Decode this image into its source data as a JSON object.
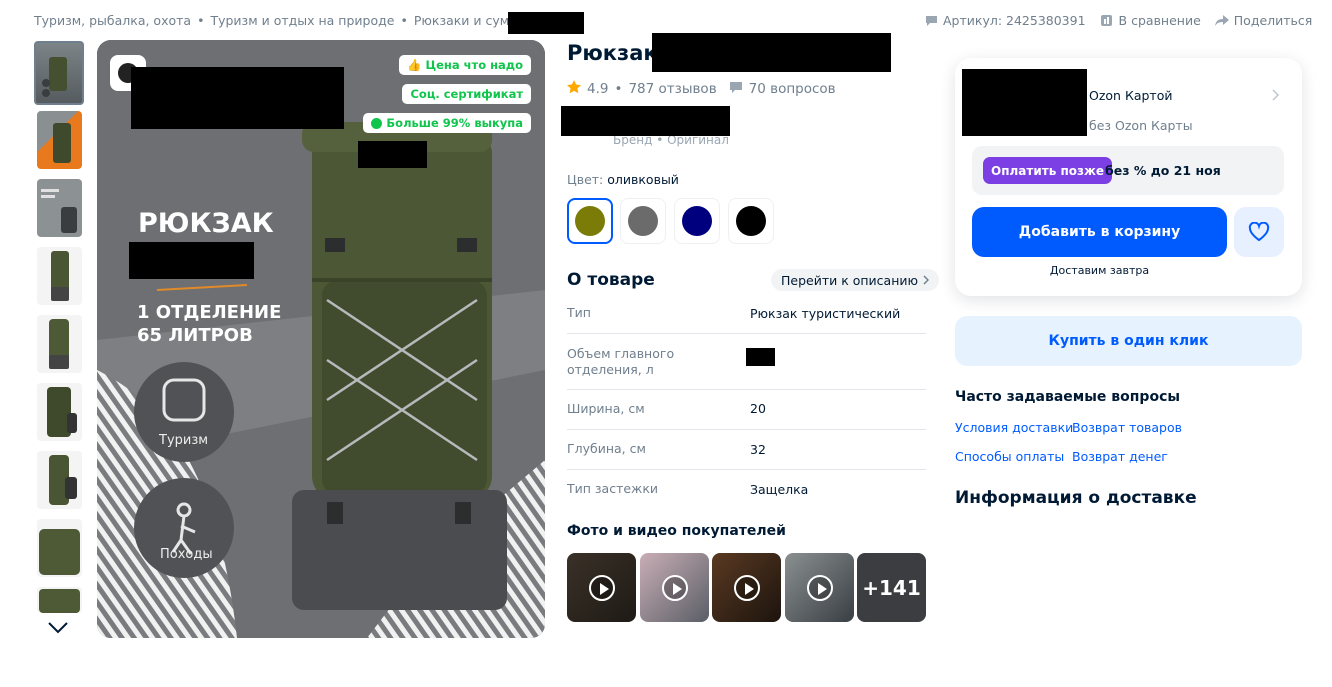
{
  "breadcrumbs": [
    "Туризм, рыбалка, охота",
    "Туризм и отдых на природе",
    "Рюкзаки и сумки"
  ],
  "breadcrumb_sep": "•",
  "top_actions": {
    "article": "Артикул: 2425380391",
    "compare": "В сравнение",
    "share": "Поделиться"
  },
  "gallery": {
    "badges": [
      "Цена что надо",
      "Соц. сертификат",
      "Больше 99% выкупа"
    ],
    "hero_text": {
      "headline": "РЮКЗАК",
      "line1": "1 ОТДЕЛЕНИЕ",
      "line2": "65 ЛИТРОВ",
      "icon1_label": "Туризм",
      "icon2_label": "Походы"
    }
  },
  "product": {
    "title": "Рюкзак",
    "rating": "4.9",
    "reviews": "787 отзывов",
    "questions": "70 вопросов",
    "brand_sub": "Бренд • Оригинал",
    "color_label": "Цвет:",
    "color_value": "оливковый",
    "swatches": [
      "#7b7c07",
      "#6b6b6b",
      "#00007f",
      "#000000"
    ],
    "about_title": "О товаре",
    "goto_description": "Перейти к описанию",
    "specs": [
      {
        "k": "Тип",
        "v": "Рюкзак туристический"
      },
      {
        "k": "Объем главного отделения, л",
        "v": ""
      },
      {
        "k": "Ширина, см",
        "v": "20"
      },
      {
        "k": "Глубина, см",
        "v": "32"
      },
      {
        "k": "Тип застежки",
        "v": "Защелка"
      }
    ],
    "photos_title": "Фото и видео покупателей",
    "photos_more": "+141"
  },
  "buy_card": {
    "ozon_card": "Ozon Картой",
    "no_ozon_card": "без Ozon Карты",
    "pay_later_btn": "Оплатить позже",
    "pay_later_text": "без % до 21 ноя",
    "add_to_cart": "Добавить в корзину",
    "delivery_note": "Доставим завтра",
    "one_click": "Купить в один клик"
  },
  "faq": {
    "title": "Часто задаваемые вопросы",
    "links": [
      "Условия доставки",
      "Возврат товаров",
      "Способы оплаты",
      "Возврат денег"
    ]
  },
  "delivery_title": "Информация о доставке",
  "colors": {
    "accent": "#005bff",
    "pay_later": "#7b3fe4",
    "badge_green": "#10c44c",
    "star": "#ffa800"
  }
}
